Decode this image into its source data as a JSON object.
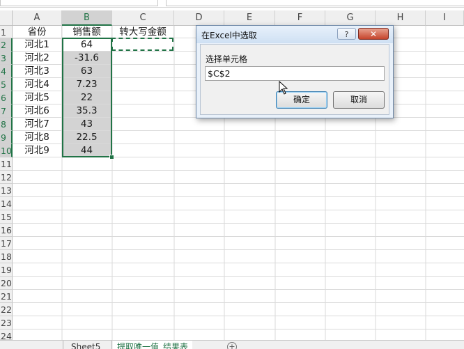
{
  "columns": [
    "A",
    "B",
    "C",
    "D",
    "E",
    "F",
    "G",
    "H",
    "I"
  ],
  "rows": [
    "1",
    "2",
    "3",
    "4",
    "5",
    "6",
    "7",
    "8",
    "9",
    "10",
    "11",
    "12",
    "13",
    "14",
    "15",
    "16",
    "17",
    "18",
    "19",
    "20",
    "21",
    "22",
    "23",
    "24"
  ],
  "grid": {
    "headers": {
      "A": "省份",
      "B": "销售额",
      "C": "转大写金额"
    },
    "data": [
      {
        "A": "河北1",
        "B": "64"
      },
      {
        "A": "河北2",
        "B": "-31.6"
      },
      {
        "A": "河北3",
        "B": "63"
      },
      {
        "A": "河北4",
        "B": "7.23"
      },
      {
        "A": "河北5",
        "B": "22"
      },
      {
        "A": "河北6",
        "B": "35.3"
      },
      {
        "A": "河北7",
        "B": "43"
      },
      {
        "A": "河北8",
        "B": "22.5"
      },
      {
        "A": "河北9",
        "B": "44"
      }
    ]
  },
  "sheet_tabs": {
    "tab1": "Sheet5",
    "tab2": "提取唯一值_结果表"
  },
  "dialog": {
    "title": "在Excel中选取",
    "help_label": "?",
    "close_label": "✕",
    "prompt": "选择单元格",
    "input_value": "$C$2",
    "ok_label": "确定",
    "cancel_label": "取消"
  },
  "colors": {
    "accent": "#217346",
    "selection_fill": "#d3d3d3",
    "dialog_bg": "#e9f1fa",
    "close_button": "#c6442c"
  }
}
